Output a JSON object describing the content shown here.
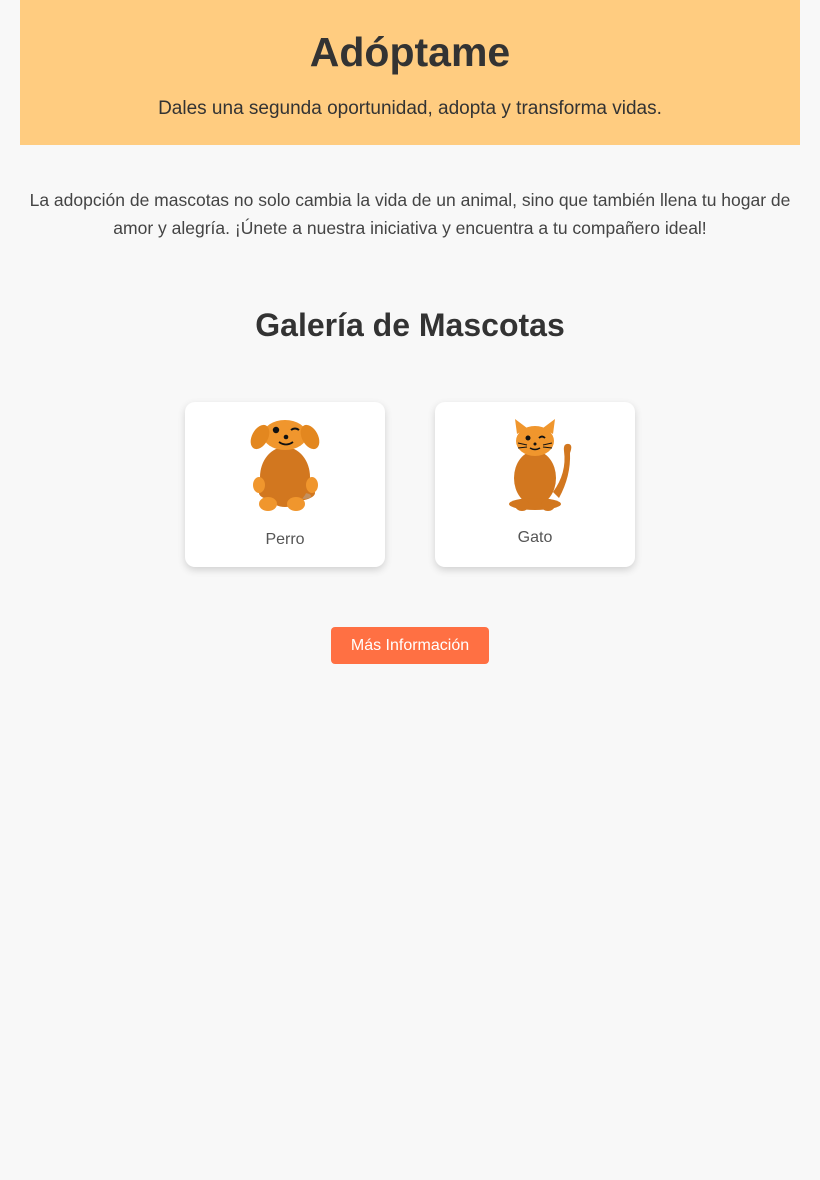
{
  "header": {
    "title": "Adóptame",
    "subtitle": "Dales una segunda oportunidad, adopta y transforma vidas."
  },
  "intro": {
    "text": "La adopción de mascotas no solo cambia la vida de un animal, sino que también llena tu hogar de amor y alegría. ¡Únete a nuestra iniciativa y encuentra a tu compañero ideal!"
  },
  "gallery": {
    "title": "Galería de Mascotas",
    "pets": [
      {
        "label": "Perro",
        "icon": "dog-icon"
      },
      {
        "label": "Gato",
        "icon": "cat-icon"
      }
    ]
  },
  "actions": {
    "more_info_label": "Más Información"
  },
  "colors": {
    "header_background": "#ffcc80",
    "page_background": "#f8f8f8",
    "button_background": "#ff7043",
    "pet_fur_dark": "#d2771f",
    "pet_fur_light": "#f0962d"
  }
}
